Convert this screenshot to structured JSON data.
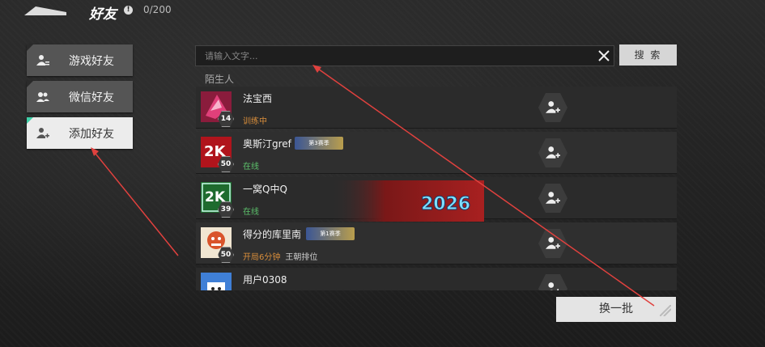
{
  "header": {
    "title": "好友",
    "count": "0/200"
  },
  "sidebar": {
    "items": [
      {
        "label": "游戏好友",
        "icon": "person-list-icon",
        "active": false
      },
      {
        "label": "微信好友",
        "icon": "people-icon",
        "active": false
      },
      {
        "label": "添加好友",
        "icon": "person-add-icon",
        "active": true
      }
    ]
  },
  "search": {
    "placeholder": "请输入文字...",
    "button_label": "搜 索"
  },
  "section_label": "陌生人",
  "friends": [
    {
      "name": "法宝西",
      "level": "14",
      "status": "训练中",
      "status_sub": "",
      "status_color": "orange",
      "badge": ""
    },
    {
      "name": "奥斯汀gref",
      "level": "50",
      "status": "在线",
      "status_sub": "",
      "status_color": "green",
      "badge": "第3赛季"
    },
    {
      "name": "一窝Q中Q",
      "level": "39",
      "status": "在线",
      "status_sub": "",
      "status_color": "green",
      "badge": "",
      "banner_text": "2026"
    },
    {
      "name": "得分的库里南",
      "level": "50",
      "status": "开局6分钟",
      "status_sub": "王朝排位",
      "status_color": "orange",
      "badge": "第1赛季"
    },
    {
      "name": "用户0308",
      "level": "",
      "status": "",
      "status_sub": "",
      "status_color": "green",
      "badge": ""
    }
  ],
  "refresh_button": "换一批",
  "colors": {
    "accent_green": "#5cc06b",
    "accent_orange": "#d98e3b",
    "active_marker": "#3fd0a8"
  }
}
